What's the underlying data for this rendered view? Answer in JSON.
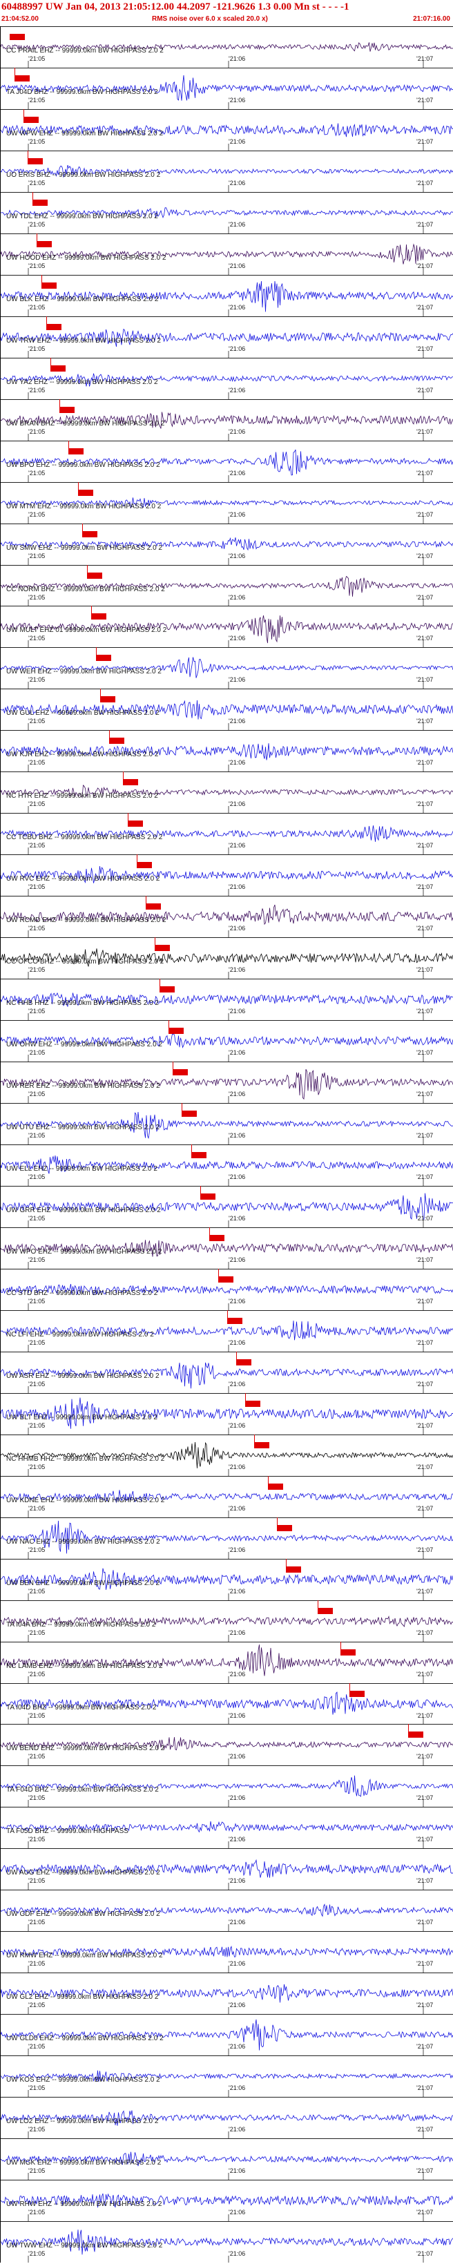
{
  "header": {
    "title": "60488997 UW Jan 04, 2013 21:05:12.00   44.2097 -121.9626  1.3 0.00 Mn st  -  -  -  -1",
    "time_start": "21:04:52.00",
    "time_end": "21:07:16.00",
    "note": "RMS noise over 6.0 x scaled 20.0 x)"
  },
  "time_ticks": [
    "21:05",
    "21:06",
    "21:07"
  ],
  "colors": {
    "trace_blue": "#1010e0",
    "trace_purple": "#3a0a5a",
    "trace_black": "#000000",
    "pick_red": "#e00000"
  },
  "traces": [
    {
      "label": "CC PRAIL EHZ -- 99999.0km BW  HIGHPASS  2.0  2",
      "color": "#3a0a5a",
      "pick": 0.02
    },
    {
      "label": "TA J04D BHZ -- 99999.0km BW  HIGHPASS  2.0  2",
      "color": "#1010e0",
      "pick": 0.03
    },
    {
      "label": "UW WPW EHZ -- 99999.0km BW  HIGHPASS  2.0  2",
      "color": "#1010e0",
      "pick": 0.05
    },
    {
      "label": "UO ERIS BHZ -- 99999.0km BW  HIGHPASS  2.0  2",
      "color": "#1010e0",
      "pick": 0.06
    },
    {
      "label": "UW TDL EHZ -- 99999.0km BW  HIGHPASS  2.0  2",
      "color": "#1010e0",
      "pick": 0.07
    },
    {
      "label": "UW HOOD EHZ -- 99999.0km BW  HIGHPASS  2.0  2",
      "color": "#3a0a5a",
      "pick": 0.08
    },
    {
      "label": "UW BLK EHZ -- 99999.0km BW  HIGHPASS  2.0  2",
      "color": "#1010e0",
      "pick": 0.09
    },
    {
      "label": "UW TRW EHZ -- 99999.0km BW  HIGHPASS  2.0  2",
      "color": "#1010e0",
      "pick": 0.1
    },
    {
      "label": "UW YA2 EHZ -- 99999.0km BW  HIGHPASS  2.0  2",
      "color": "#1010e0",
      "pick": 0.11
    },
    {
      "label": "UW BRAN BHZ -- 99999.0km BW  HIGHPASS  2.0  2",
      "color": "#3a0a5a",
      "pick": 0.13
    },
    {
      "label": "UW BPO EHZ -- 99999.0km BW  HIGHPASS  2.0  2",
      "color": "#1010e0",
      "pick": 0.15
    },
    {
      "label": "UW MTM EHZ -- 99999.0km BW  HIGHPASS  2.0  2",
      "color": "#1010e0",
      "pick": 0.17
    },
    {
      "label": "UW SMW EHZ -- 99999.0km BW  HIGHPASS  2.0  2",
      "color": "#1010e0",
      "pick": 0.18
    },
    {
      "label": "CC NORM BHZ -- 99999.0km BW  HIGHPASS  2.0  2",
      "color": "#3a0a5a",
      "pick": 0.19
    },
    {
      "label": "UW MULT EHZ 01 99999.0km BW  HIGHPASS  2.0  2",
      "color": "#3a0a5a",
      "pick": 0.2
    },
    {
      "label": "UW WEH EHZ -- 99999.0km BW  HIGHPASS  2.0  2",
      "color": "#1010e0",
      "pick": 0.21
    },
    {
      "label": "UW GUL EHZ -- 99999.0km BW  HIGHPASS  2.0  2",
      "color": "#1010e0",
      "pick": 0.22
    },
    {
      "label": "UW KJR EHZ -- 99999.0km BW  HIGHPASS  2.0  2",
      "color": "#1010e0",
      "pick": 0.24
    },
    {
      "label": "NC HTR EHZ -- 99999.0km BW  HIGHPASS  2.0  2",
      "color": "#3a0a5a",
      "pick": 0.27
    },
    {
      "label": "CC TCBU BHZ -- 99999.0km BW  HIGHPASS  2.0  2",
      "color": "#1010e0",
      "pick": 0.28
    },
    {
      "label": "UW RVC EHZ -- 99999.0km BW  HIGHPASS  2.0  2",
      "color": "#1010e0",
      "pick": 0.3
    },
    {
      "label": "UW RCMD EHZ -- 99999.0km BW  HIGHPASS  2.0  2",
      "color": "#3a0a5a",
      "pick": 0.32
    },
    {
      "label": "CC OFCO BHZ -- 99999.0km BW  HIGHPASS  2.0  2",
      "color": "#000000",
      "pick": 0.34
    },
    {
      "label": "NC HHB HHZ -- 99999.0km BW  HIGHPASS  2.0  2",
      "color": "#1010e0",
      "pick": 0.35
    },
    {
      "label": "UW OHW EHZ -- 99999.0km BW  HIGHPASS  2.0  2",
      "color": "#1010e0",
      "pick": 0.37
    },
    {
      "label": "UW RER EHZ -- 99999.0km BW  HIGHPASS  2.0  2",
      "color": "#3a0a5a",
      "pick": 0.38
    },
    {
      "label": "UW UTU EHZ -- 99999.0km BW  HIGHPASS  2.0  2",
      "color": "#1010e0",
      "pick": 0.4
    },
    {
      "label": "UW ELL EHZ -- 99999.0km BW  HIGHPASS  2.0  2",
      "color": "#1010e0",
      "pick": 0.42
    },
    {
      "label": "UW GRR EHZ -- 99999.0km BW  HIGHPASS  2.0  2",
      "color": "#1010e0",
      "pick": 0.44
    },
    {
      "label": "UW WPO EHZ -- 99999.0km BW  HIGHPASS  2.0  2",
      "color": "#3a0a5a",
      "pick": 0.46
    },
    {
      "label": "CC STD BHZ -- 99999.0km BW  HIGHPASS  2.0  2",
      "color": "#1010e0",
      "pick": 0.48
    },
    {
      "label": "NC LFI EHZ -- 99999.0km BW  HIGHPASS  2.0  2",
      "color": "#1010e0",
      "pick": 0.5
    },
    {
      "label": "UW ASR EHZ -- 99999.0km BW  HIGHPASS  2.0  2",
      "color": "#1010e0",
      "pick": 0.52
    },
    {
      "label": "UW BLT EHZ -- 99999.0km BW  HIGHPASS  2.0  2",
      "color": "#1010e0",
      "pick": 0.54
    },
    {
      "label": "NC HHMB HHZ -- 99999.0km BW  HIGHPASS  2.0  2",
      "color": "#000000",
      "pick": 0.56
    },
    {
      "label": "UW KDNE EHZ -- 99999.0km BW  HIGHPASS  2.0  2",
      "color": "#1010e0",
      "pick": 0.59
    },
    {
      "label": "UW NAC EHZ -- 99999.0km BW  HIGHPASS  2.0  2",
      "color": "#1010e0",
      "pick": 0.61
    },
    {
      "label": "UW BEN EHZ -- 99999.0km BW  HIGHPASS  2.0  2",
      "color": "#1010e0",
      "pick": 0.63
    },
    {
      "label": "TA I04A BHZ -- 99999.0km BW  HIGHPASS  2.0  2",
      "color": "#3a0a5a",
      "pick": 0.7
    },
    {
      "label": "NC LAMB EHZ -- 99999.0km BW  HIGHPASS  2.0  2",
      "color": "#3a0a5a",
      "pick": 0.75
    },
    {
      "label": "TA I04D BHZ -- 99999.0km BW  HIGHPASS  2.0  2",
      "color": "#1010e0",
      "pick": 0.77
    },
    {
      "label": "UW BEND EHZ -- 99999.0km BW  HIGHPASS  2.0  2",
      "color": "#3a0a5a",
      "pick": 0.9
    },
    {
      "label": "TA F04D BHZ -- 99999.0km BW  HIGHPASS  2.0  2",
      "color": "#1010e0",
      "pick": null
    },
    {
      "label": "TA F05D BHZ -- 99999.0km  HIGHPASS",
      "color": "#1010e0",
      "pick": null
    },
    {
      "label": "UW AUG EHZ -- 99999.0km BW  HIGHPASS  2.0  2",
      "color": "#1010e0",
      "pick": null
    },
    {
      "label": "UW GDF EHZ -- 99999.0km BW  HIGHPASS  2.0  2",
      "color": "#1010e0",
      "pick": null
    },
    {
      "label": "UW RMW EHZ -- 99999.0km BW  HIGHPASS  2.0  2",
      "color": "#1010e0",
      "pick": null
    },
    {
      "label": "UW GL2 EHZ -- 99999.0km BW  HIGHPASS  2.0  2",
      "color": "#1010e0",
      "pick": null
    },
    {
      "label": "UW GLD0 EHZ -- 99999.0km BW  HIGHPASS  2.0  2",
      "color": "#1010e0",
      "pick": null
    },
    {
      "label": "UW KOS EHZ -- 99999.0km BW  HIGHPASS  2.0  2",
      "color": "#1010e0",
      "pick": null
    },
    {
      "label": "UW LO2 EHZ -- 99999.0km BW  HIGHPASS  2.0  2",
      "color": "#1010e0",
      "pick": null
    },
    {
      "label": "UW MGK EHZ -- 99999.0km BW  HIGHPASS  2.0  2",
      "color": "#1010e0",
      "pick": null
    },
    {
      "label": "UW RHW EHZ -- 99999.0km BW  HIGHPASS  2.0  2",
      "color": "#1010e0",
      "pick": null
    },
    {
      "label": "UW TWW EHZ -- 99999.0km BW  HIGHPASS  2.0  2",
      "color": "#1010e0",
      "pick": null
    }
  ]
}
